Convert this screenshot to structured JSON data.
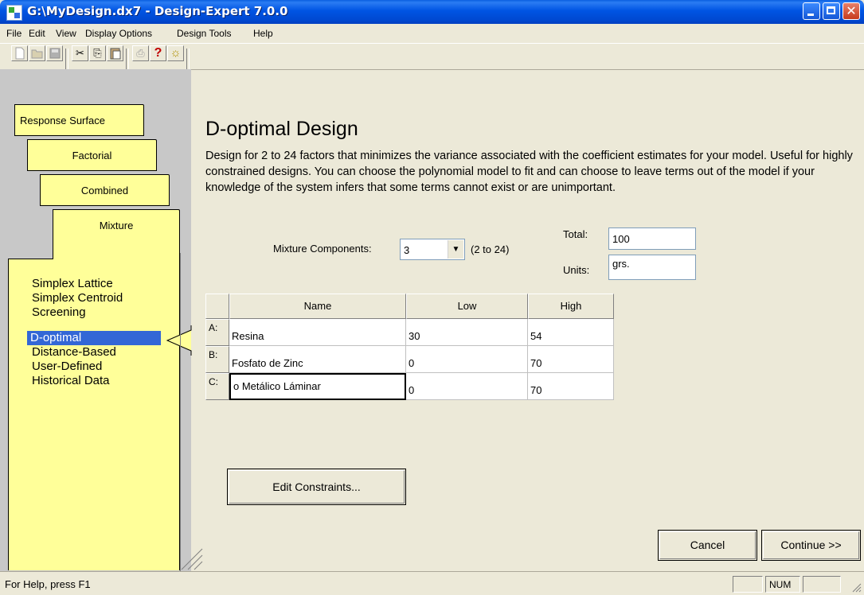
{
  "window": {
    "title": "G:\\MyDesign.dx7 - Design-Expert 7.0.0",
    "close_glyph": "✕"
  },
  "menu": [
    "File",
    "Edit",
    "View",
    "Display Options",
    "Design Tools",
    "Help"
  ],
  "toolbar": {
    "icons": [
      "new-file-icon",
      "open-folder-icon",
      "save-icon",
      "cut-icon",
      "copy-icon",
      "paste-icon",
      "print-icon",
      "help-question-icon",
      "tip-lightbulb-icon"
    ],
    "cut_glyph": "✂",
    "copy_glyph": "⎘",
    "paste_glyph": "📋",
    "print_glyph": "⎙",
    "help_glyph": "?",
    "tip_glyph": "☼"
  },
  "sidebar": {
    "tabs": [
      "Response Surface",
      "Factorial",
      "Combined",
      "Mixture"
    ],
    "methods": [
      "Simplex Lattice",
      "Simplex Centroid",
      "Screening",
      "D-optimal",
      "Distance-Based",
      "User-Defined",
      "Historical Data"
    ],
    "selected_method": "D-optimal"
  },
  "main": {
    "title": "D-optimal Design",
    "description": "Design for 2 to 24 factors that minimizes the variance associated with the coefficient estimates for your model.  Useful for highly constrained designs.  You can choose the polynomial model to fit and can choose to leave terms out of the model if your knowledge of the system infers that some terms cannot exist or are unimportant.",
    "mixture_components_label": "Mixture Components:",
    "mixture_components_value": "3",
    "range_hint": "(2 to 24)",
    "total_label": "Total:",
    "total_value": "100",
    "units_label": "Units:",
    "units_value": "grs.",
    "table": {
      "headers": [
        "Name",
        "Low",
        "High"
      ],
      "rows": [
        {
          "label": "A:",
          "name": "Resina",
          "low": "30",
          "high": "54"
        },
        {
          "label": "B:",
          "name": "Fosfato de Zinc",
          "low": "0",
          "high": "70"
        },
        {
          "label": "C:",
          "name": "o Metálico Láminar",
          "low": "0",
          "high": "70"
        }
      ]
    },
    "edit_constraints_label": "Edit Constraints...",
    "cancel_label": "Cancel",
    "continue_label": "Continue >>"
  },
  "status": {
    "text": "For Help, press F1",
    "num": "NUM"
  }
}
